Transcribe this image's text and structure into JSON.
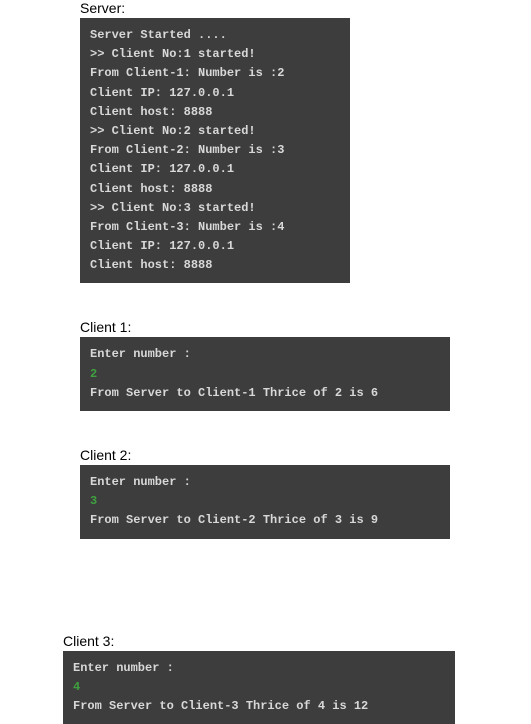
{
  "server": {
    "label": "Server:",
    "lines": [
      "Server Started ....",
      " >> Client No:1 started!",
      "From Client-1: Number is :2",
      "Client IP: 127.0.0.1",
      "Client host: 8888",
      " >> Client No:2 started!",
      "From Client-2: Number is :3",
      "Client IP: 127.0.0.1",
      "Client host: 8888",
      " >> Client No:3 started!",
      "From Client-3: Number is :4",
      "Client IP: 127.0.0.1",
      "Client host: 8888"
    ]
  },
  "client1": {
    "label": "Client 1:",
    "prompt": "Enter number :",
    "input": "2",
    "response": "From Server to Client-1 Thrice of 2 is 6"
  },
  "client2": {
    "label": "Client 2:",
    "prompt": "Enter number :",
    "input": "3",
    "response": "From Server to Client-2 Thrice of 3 is 9"
  },
  "client3": {
    "label": "Client 3:",
    "prompt": "Enter number :",
    "input": "4",
    "response": "From Server to Client-3 Thrice of 4 is 12"
  }
}
